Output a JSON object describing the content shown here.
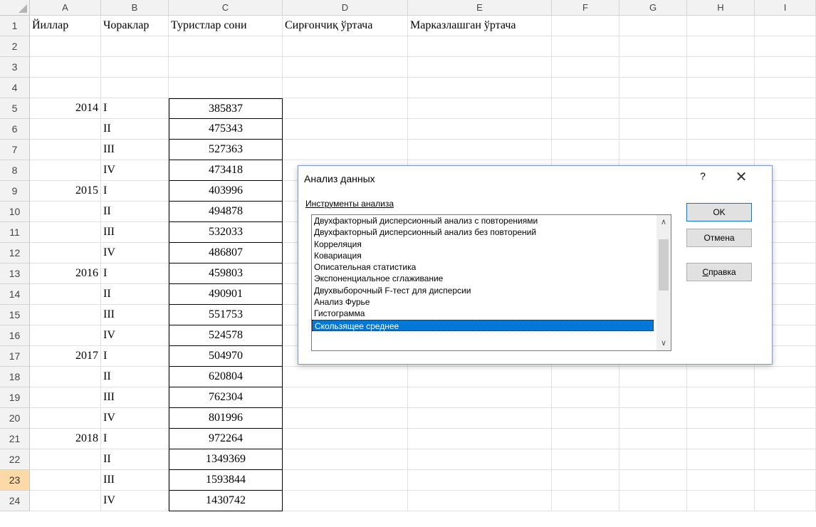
{
  "columns": [
    "A",
    "B",
    "C",
    "D",
    "E",
    "F",
    "G",
    "H",
    "I"
  ],
  "header_row": [
    "Йиллар",
    "Чораклар",
    "Туристлар сони",
    "Сирғончиқ ўртача",
    "Марказлашган ўртача"
  ],
  "rows": [
    {
      "n": "1"
    },
    {
      "n": "2"
    },
    {
      "n": "3"
    },
    {
      "n": "4"
    },
    {
      "n": "5",
      "year": "2014",
      "q": "I",
      "v": "385837"
    },
    {
      "n": "6",
      "year": "",
      "q": "II",
      "v": "475343"
    },
    {
      "n": "7",
      "year": "",
      "q": "III",
      "v": "527363"
    },
    {
      "n": "8",
      "year": "",
      "q": "IV",
      "v": "473418"
    },
    {
      "n": "9",
      "year": "2015",
      "q": "I",
      "v": "403996"
    },
    {
      "n": "10",
      "year": "",
      "q": "II",
      "v": "494878"
    },
    {
      "n": "11",
      "year": "",
      "q": "III",
      "v": "532033"
    },
    {
      "n": "12",
      "year": "",
      "q": "IV",
      "v": "486807"
    },
    {
      "n": "13",
      "year": "2016",
      "q": "I",
      "v": "459803"
    },
    {
      "n": "14",
      "year": "",
      "q": "II",
      "v": "490901"
    },
    {
      "n": "15",
      "year": "",
      "q": "III",
      "v": "551753"
    },
    {
      "n": "16",
      "year": "",
      "q": "IV",
      "v": "524578"
    },
    {
      "n": "17",
      "year": "2017",
      "q": "I",
      "v": "504970"
    },
    {
      "n": "18",
      "year": "",
      "q": "II",
      "v": "620804"
    },
    {
      "n": "19",
      "year": "",
      "q": "III",
      "v": "762304"
    },
    {
      "n": "20",
      "year": "",
      "q": "IV",
      "v": "801996"
    },
    {
      "n": "21",
      "year": "2018",
      "q": "I",
      "v": "972264"
    },
    {
      "n": "22",
      "year": "",
      "q": "II",
      "v": "1349369"
    },
    {
      "n": "23",
      "year": "",
      "q": "III",
      "v": "1593844"
    },
    {
      "n": "24",
      "year": "",
      "q": "IV",
      "v": "1430742"
    }
  ],
  "selected_row": "23",
  "dialog": {
    "title": "Анализ данных",
    "help": "?",
    "close": "✕",
    "tools_label": "Инструменты анализа",
    "tools": [
      "Двухфакторный дисперсионный анализ с повторениями",
      "Двухфакторный дисперсионный анализ без повторений",
      "Корреляция",
      "Ковариация",
      "Описательная статистика",
      "Экспоненциальное сглаживание",
      "Двухвыборочный F-тест для дисперсии",
      "Анализ Фурье",
      "Гистограмма",
      "Скользящее среднее"
    ],
    "selected_tool": "Скользящее среднее",
    "ok": "OK",
    "cancel": "Отмена",
    "help_button": "Справка"
  },
  "colors": {
    "header_bg": "#f2f2f2",
    "selected_header": "#fcd9a6",
    "selection_blue": "#0078d7"
  }
}
